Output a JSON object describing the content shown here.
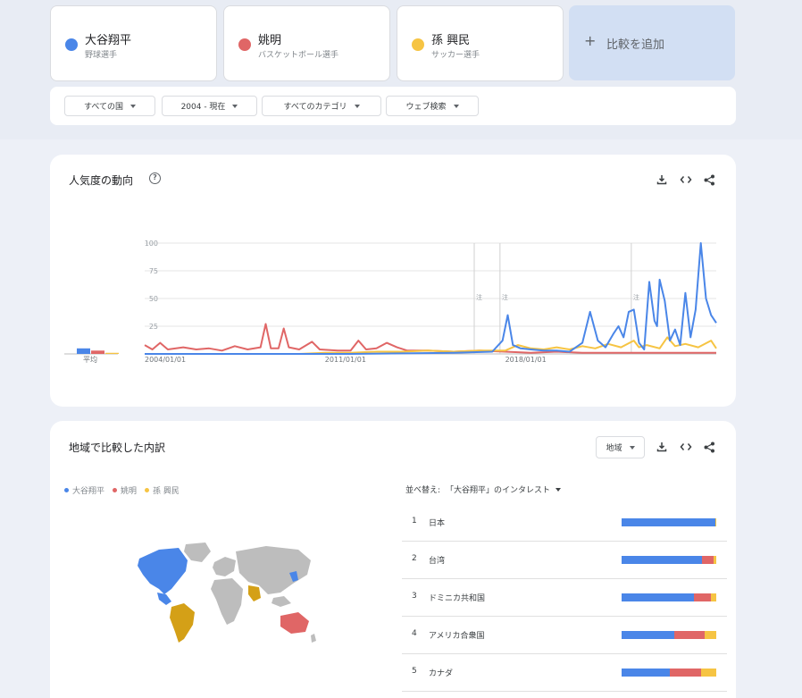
{
  "terms": [
    {
      "name": "大谷翔平",
      "sub": "野球選手",
      "color": "#4a86e8"
    },
    {
      "name": "姚明",
      "sub": "バスケットボール選手",
      "color": "#e06666"
    },
    {
      "name": "孫 興民",
      "sub": "サッカー選手",
      "color": "#f6c443"
    }
  ],
  "add_compare": {
    "plus": "+",
    "label": "比較を追加"
  },
  "filters": [
    "すべての国",
    "2004 - 現在",
    "すべてのカテゴリ",
    "ウェブ検索"
  ],
  "trend": {
    "title": "人気度の動向",
    "help": "?",
    "avg_label": "平均",
    "note_label": "注",
    "y_ticks": [
      "100",
      "75",
      "50",
      "25"
    ],
    "x_ticks": [
      "2004/01/01",
      "2011/01/01",
      "2018/01/01"
    ]
  },
  "chart_data": {
    "type": "line",
    "x_ticks": [
      "2004/01/01",
      "2011/01/01",
      "2018/01/01"
    ],
    "ylim": [
      0,
      100
    ],
    "series": [
      {
        "name": "大谷翔平",
        "color": "#4a86e8",
        "average": 5,
        "values": [
          [
            2004.0,
            0
          ],
          [
            2012.0,
            0
          ],
          [
            2016.0,
            1
          ],
          [
            2017.5,
            2
          ],
          [
            2017.9,
            12
          ],
          [
            2018.1,
            35
          ],
          [
            2018.3,
            8
          ],
          [
            2018.6,
            5
          ],
          [
            2019.0,
            4
          ],
          [
            2019.5,
            3
          ],
          [
            2020.0,
            3
          ],
          [
            2020.5,
            2
          ],
          [
            2021.0,
            10
          ],
          [
            2021.3,
            38
          ],
          [
            2021.6,
            12
          ],
          [
            2021.9,
            6
          ],
          [
            2022.2,
            18
          ],
          [
            2022.4,
            25
          ],
          [
            2022.6,
            15
          ],
          [
            2022.8,
            38
          ],
          [
            2023.0,
            40
          ],
          [
            2023.2,
            10
          ],
          [
            2023.4,
            4
          ],
          [
            2023.6,
            65
          ],
          [
            2023.8,
            30
          ],
          [
            2023.9,
            25
          ],
          [
            2024.0,
            67
          ],
          [
            2024.2,
            48
          ],
          [
            2024.4,
            12
          ],
          [
            2024.6,
            22
          ],
          [
            2024.8,
            8
          ],
          [
            2025.0,
            55
          ],
          [
            2025.2,
            15
          ],
          [
            2025.4,
            40
          ],
          [
            2025.6,
            100
          ],
          [
            2025.8,
            50
          ],
          [
            2026.0,
            35
          ],
          [
            2026.2,
            28
          ]
        ]
      },
      {
        "name": "姚明",
        "color": "#e06666",
        "average": 3,
        "values": [
          [
            2004.0,
            8
          ],
          [
            2004.3,
            4
          ],
          [
            2004.6,
            10
          ],
          [
            2004.9,
            4
          ],
          [
            2005.5,
            6
          ],
          [
            2006.0,
            4
          ],
          [
            2006.5,
            5
          ],
          [
            2007.0,
            3
          ],
          [
            2007.5,
            7
          ],
          [
            2008.0,
            4
          ],
          [
            2008.5,
            6
          ],
          [
            2008.7,
            27
          ],
          [
            2008.9,
            5
          ],
          [
            2009.2,
            5
          ],
          [
            2009.4,
            23
          ],
          [
            2009.6,
            6
          ],
          [
            2010.0,
            4
          ],
          [
            2010.5,
            11
          ],
          [
            2010.8,
            4
          ],
          [
            2011.5,
            3
          ],
          [
            2012.0,
            3
          ],
          [
            2012.3,
            12
          ],
          [
            2012.6,
            4
          ],
          [
            2013.0,
            5
          ],
          [
            2013.4,
            10
          ],
          [
            2013.8,
            6
          ],
          [
            2014.2,
            3
          ],
          [
            2015.0,
            3
          ],
          [
            2016.0,
            2
          ],
          [
            2017.0,
            3
          ],
          [
            2018.0,
            2
          ],
          [
            2019.0,
            1
          ],
          [
            2020.0,
            2
          ],
          [
            2021.0,
            1
          ],
          [
            2022.0,
            1
          ],
          [
            2023.0,
            1
          ],
          [
            2024.0,
            1
          ],
          [
            2025.0,
            1
          ],
          [
            2026.2,
            1
          ]
        ]
      },
      {
        "name": "孫 興民",
        "color": "#f6c443",
        "average": 1,
        "values": [
          [
            2004.0,
            0
          ],
          [
            2010.0,
            0
          ],
          [
            2011.0,
            1
          ],
          [
            2012.0,
            1
          ],
          [
            2013.0,
            2
          ],
          [
            2014.0,
            2
          ],
          [
            2015.0,
            3
          ],
          [
            2016.0,
            2
          ],
          [
            2017.0,
            3
          ],
          [
            2018.0,
            3
          ],
          [
            2018.5,
            8
          ],
          [
            2019.0,
            5
          ],
          [
            2019.5,
            4
          ],
          [
            2020.0,
            6
          ],
          [
            2020.5,
            4
          ],
          [
            2021.0,
            7
          ],
          [
            2021.5,
            5
          ],
          [
            2022.0,
            9
          ],
          [
            2022.5,
            6
          ],
          [
            2023.0,
            12
          ],
          [
            2023.2,
            6
          ],
          [
            2023.5,
            8
          ],
          [
            2024.0,
            5
          ],
          [
            2024.3,
            15
          ],
          [
            2024.6,
            7
          ],
          [
            2025.0,
            9
          ],
          [
            2025.5,
            6
          ],
          [
            2026.0,
            12
          ],
          [
            2026.2,
            5
          ]
        ]
      }
    ]
  },
  "region": {
    "title": "地域で比較した内訳",
    "select": "地域",
    "legend": [
      "大谷翔平",
      "姚明",
      "孫 興民"
    ],
    "sort_label": "並べ替え:",
    "sort_value": "「大谷翔平」のインタレスト",
    "rows": [
      {
        "rank": "1",
        "name": "日本",
        "shares": [
          0.99,
          0.0,
          0.01
        ]
      },
      {
        "rank": "2",
        "name": "台湾",
        "shares": [
          0.85,
          0.12,
          0.03
        ]
      },
      {
        "rank": "3",
        "name": "ドミニカ共和国",
        "shares": [
          0.76,
          0.18,
          0.06
        ]
      },
      {
        "rank": "4",
        "name": "アメリカ合衆国",
        "shares": [
          0.56,
          0.32,
          0.12
        ]
      },
      {
        "rank": "5",
        "name": "カナダ",
        "shares": [
          0.51,
          0.33,
          0.16
        ]
      }
    ]
  }
}
